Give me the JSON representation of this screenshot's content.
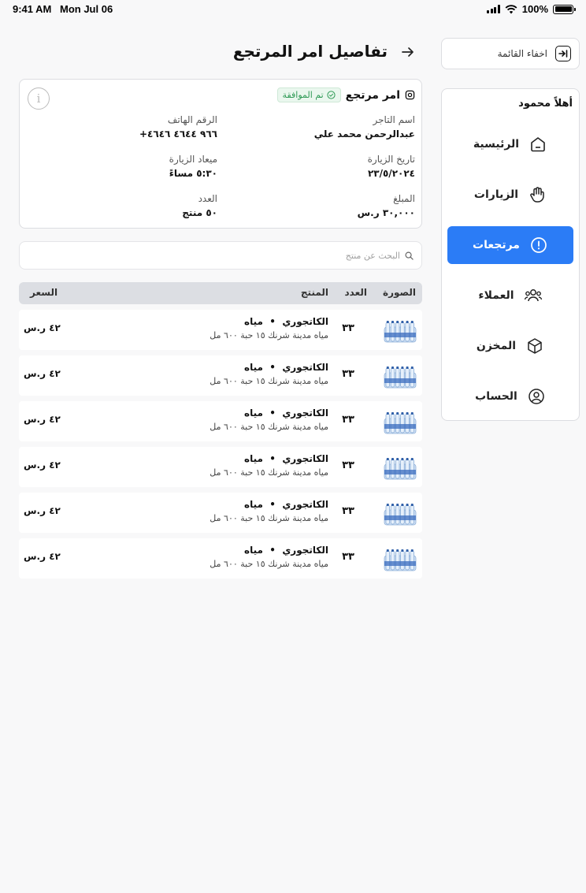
{
  "status_bar": {
    "time": "9:41 AM",
    "date": "Mon Jul 06",
    "battery": "100%"
  },
  "sidebar": {
    "hide_label": "اخفاء القائمة",
    "greeting": "أهلاً محمود",
    "items": [
      {
        "label": "الرئيسية",
        "icon": "home-icon",
        "active": false
      },
      {
        "label": "الزيارات",
        "icon": "hand-icon",
        "active": false
      },
      {
        "label": "مرتجعات",
        "icon": "alert-circle-icon",
        "active": true
      },
      {
        "label": "العملاء",
        "icon": "users-icon",
        "active": false
      },
      {
        "label": "المخزن",
        "icon": "box-icon",
        "active": false
      },
      {
        "label": "الحساب",
        "icon": "user-circle-icon",
        "active": false
      }
    ]
  },
  "header": {
    "title": "تفاصيل امر المرتجع"
  },
  "order": {
    "title": "امر مرتجع",
    "status": "تم الموافقة",
    "fields": {
      "merchant_label": "اسم التاجر",
      "merchant_value": "عبدالرحمن محمد علي",
      "phone_label": "الرقم الهاتف",
      "phone_value": "+٩٦٦ ٤٦٤٤ ٤٦٤٦",
      "visit_date_label": "تاريخ الزيارة",
      "visit_date_value": "٢٣/٥/٢٠٢٤",
      "visit_time_label": "ميعاد الزيارة",
      "visit_time_value": "٥:٣٠ مساءً",
      "amount_label": "المبلغ",
      "amount_value": "٣٠,٠٠٠ ر.س",
      "count_label": "العدد",
      "count_value": "٥٠ منتج"
    }
  },
  "search": {
    "placeholder": "البحث عن منتج"
  },
  "table": {
    "headers": {
      "image": "الصورة",
      "qty": "العدد",
      "product": "المنتج",
      "price": "السعر"
    },
    "rows": [
      {
        "name": "مياه",
        "category": "الكاتجوري",
        "desc": "مياه مدينة شرنك ١٥ حبة ٦٠٠ مل",
        "qty": "٣٣",
        "price": "٤٢ ر.س"
      },
      {
        "name": "مياه",
        "category": "الكاتجوري",
        "desc": "مياه مدينة شرنك ١٥ حبة ٦٠٠ مل",
        "qty": "٣٣",
        "price": "٤٢ ر.س"
      },
      {
        "name": "مياه",
        "category": "الكاتجوري",
        "desc": "مياه مدينة شرنك ١٥ حبة ٦٠٠ مل",
        "qty": "٣٣",
        "price": "٤٢ ر.س"
      },
      {
        "name": "مياه",
        "category": "الكاتجوري",
        "desc": "مياه مدينة شرنك ١٥ حبة ٦٠٠ مل",
        "qty": "٣٣",
        "price": "٤٢ ر.س"
      },
      {
        "name": "مياه",
        "category": "الكاتجوري",
        "desc": "مياه مدينة شرنك ١٥ حبة ٦٠٠ مل",
        "qty": "٣٣",
        "price": "٤٢ ر.س"
      },
      {
        "name": "مياه",
        "category": "الكاتجوري",
        "desc": "مياه مدينة شرنك ١٥ حبة ٦٠٠ مل",
        "qty": "٣٣",
        "price": "٤٢ ر.س"
      }
    ]
  },
  "colors": {
    "accent": "#2b7cf6",
    "success": "#2e9a55",
    "header_bg": "#dcdee3"
  }
}
